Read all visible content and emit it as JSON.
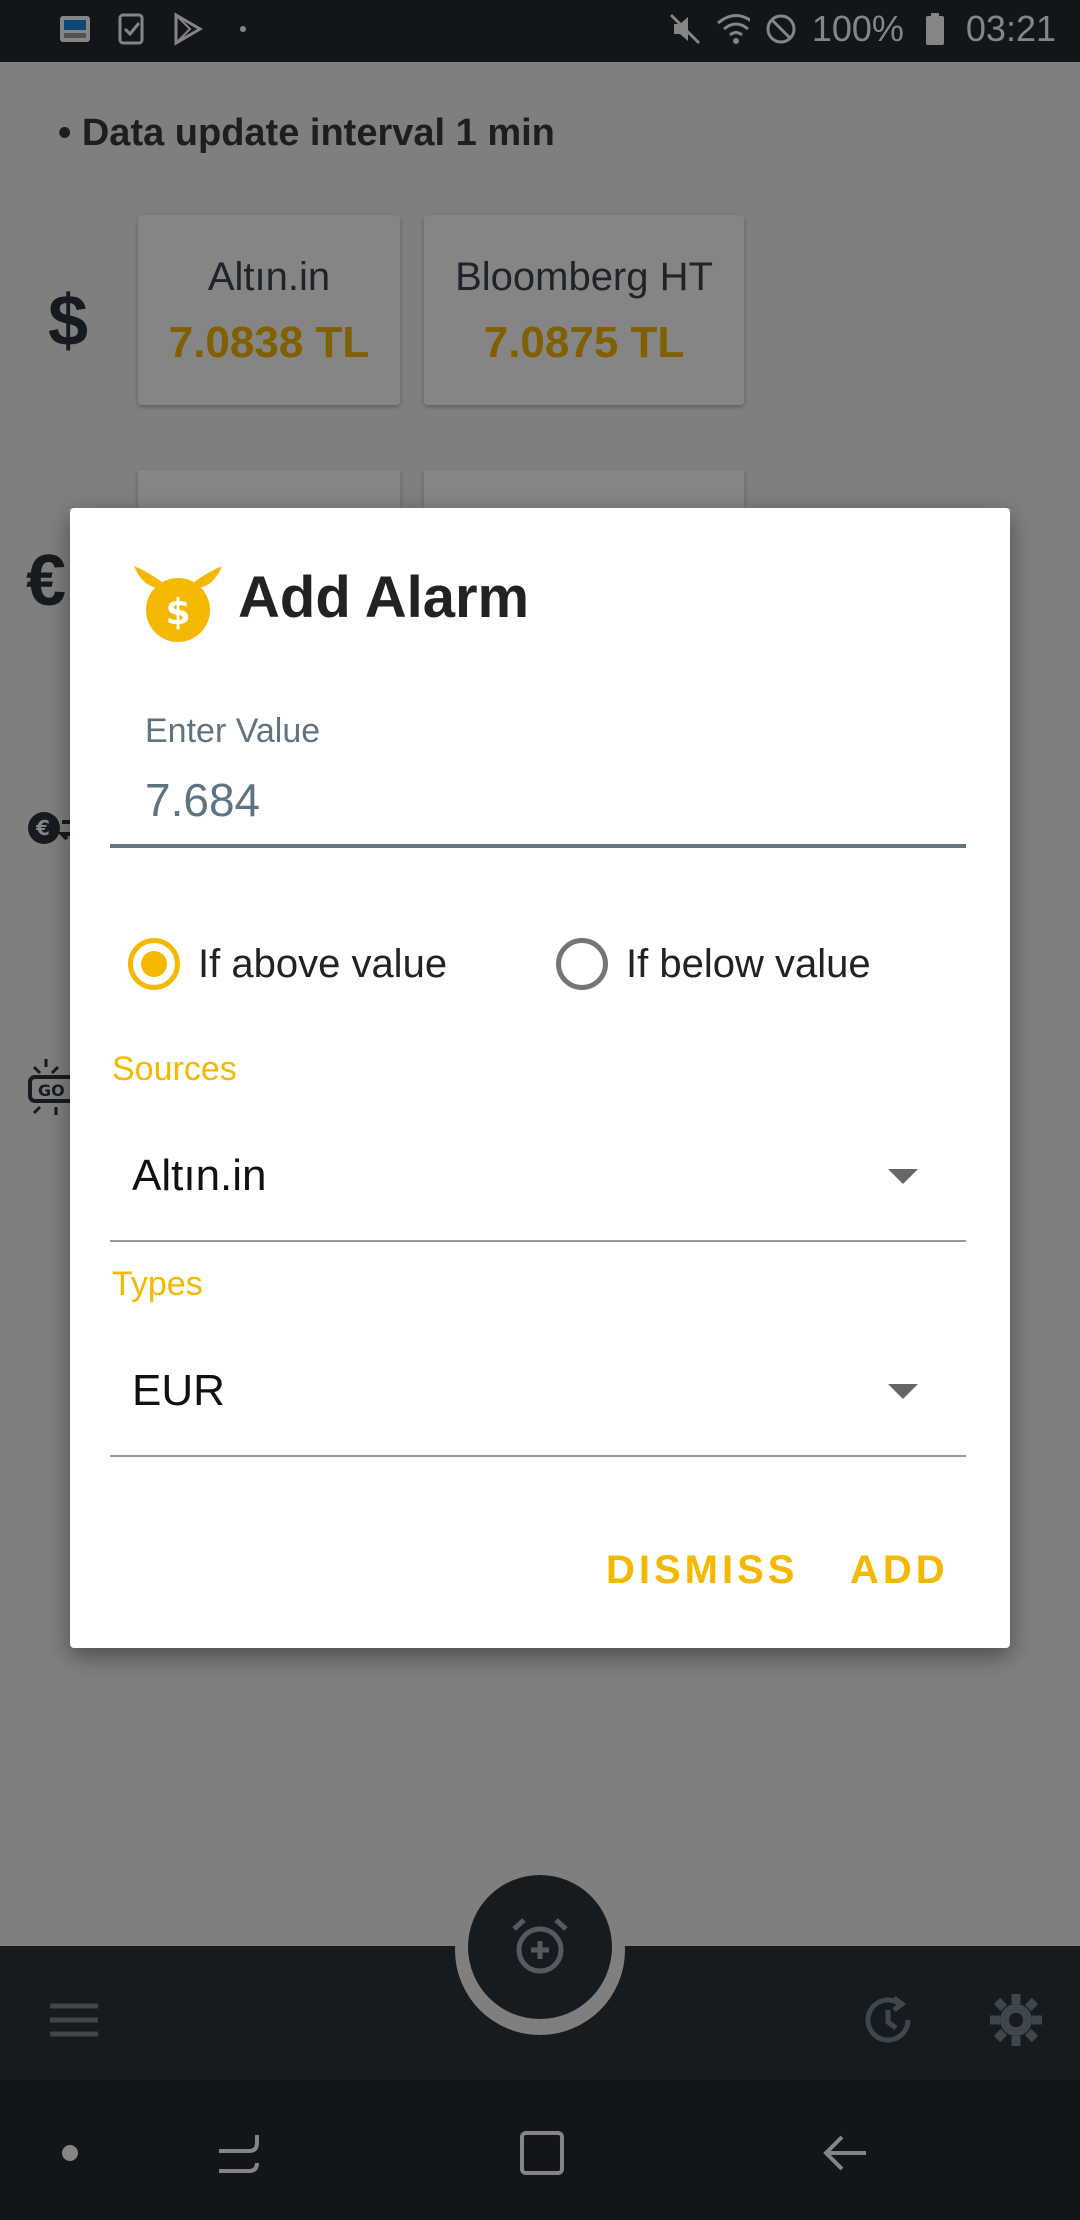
{
  "status_bar": {
    "battery": "100%",
    "time": "03:21",
    "notification_icons": [
      "weather-app-icon",
      "checklist-icon",
      "play-store-icon",
      "dot-icon"
    ],
    "system_icons": [
      "mute-icon",
      "wifi-icon",
      "do-not-disturb-icon",
      "battery-icon"
    ]
  },
  "background": {
    "interval_text": "• Data update interval 1 min",
    "currency_sign": "$",
    "cards": [
      {
        "source": "Altın.in",
        "value": "7.0838 TL"
      },
      {
        "source": "Bloomberg HT",
        "value": "7.0875 TL"
      }
    ]
  },
  "dialog": {
    "title": "Add Alarm",
    "field_label": "Enter Value",
    "field_value": "7.684",
    "radio_above": "If above value",
    "radio_below": "If below value",
    "radio_selected": "above",
    "sources_label": "Sources",
    "sources_value": "Altın.in",
    "types_label": "Types",
    "types_value": "EUR",
    "dismiss_label": "DISMISS",
    "add_label": "ADD"
  },
  "colors": {
    "accent": "#f5b800",
    "dark": "#2b353f",
    "field": "#5f7482"
  }
}
